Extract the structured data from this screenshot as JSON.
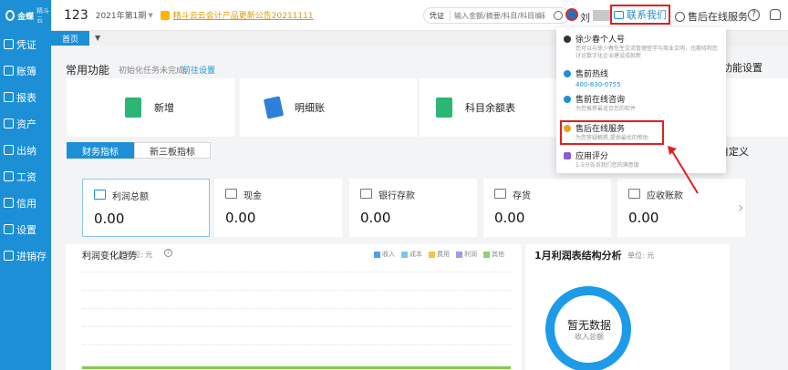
{
  "sidebar": {
    "logo": {
      "name": "金蝶精斗云",
      "brand": "金蝶",
      "product": "精斗云"
    },
    "items": [
      {
        "label": "凭证",
        "icon": "voucher-icon"
      },
      {
        "label": "账簿",
        "icon": "ledger-icon"
      },
      {
        "label": "报表",
        "icon": "report-icon"
      },
      {
        "label": "资产",
        "icon": "asset-icon"
      },
      {
        "label": "出纳",
        "icon": "cashier-icon"
      },
      {
        "label": "工资",
        "icon": "salary-icon"
      },
      {
        "label": "信用",
        "icon": "credit-icon"
      },
      {
        "label": "设置",
        "icon": "settings-icon"
      },
      {
        "label": "进销存",
        "icon": "inventory-icon"
      }
    ]
  },
  "header": {
    "account_no": "123",
    "period": "2021年第1期",
    "notice": "精斗云云会计产品更新公告20211111",
    "search": {
      "type": "凭证",
      "placeholder": "输入金额/摘要/科目/科目编码"
    },
    "user_name": "刘",
    "contact_label": "联系我们",
    "after_sale_label": "售后在线服务"
  },
  "tabstrip": {
    "home": "首页"
  },
  "common": {
    "title": "常用功能",
    "hint": "初始化任务未完成,",
    "link": "前往设置",
    "settings": "功能设置",
    "items": [
      {
        "label": "新增",
        "icon": "add-icon",
        "color": "#2bb673"
      },
      {
        "label": "明细账",
        "icon": "detail-ledger-icon",
        "color": "#2d7fd8"
      },
      {
        "label": "科目余额表",
        "icon": "balance-sheet-icon",
        "color": "#2bb673"
      }
    ]
  },
  "indicator_tabs": {
    "tabs": [
      "财务指标",
      "新三板指标"
    ],
    "customize": "自定义"
  },
  "metrics": [
    {
      "label": "利润总额",
      "value": "0.00"
    },
    {
      "label": "现金",
      "value": "0.00"
    },
    {
      "label": "银行存款",
      "value": "0.00"
    },
    {
      "label": "存货",
      "value": "0.00"
    },
    {
      "label": "应收账款",
      "value": "0.00"
    }
  ],
  "trend": {
    "title": "利润变化趋势",
    "unit": "单位: 元",
    "legend": [
      {
        "label": "收入",
        "color": "#4aa3e8"
      },
      {
        "label": "成本",
        "color": "#7fc4ee"
      },
      {
        "label": "费用",
        "color": "#f6c34a"
      },
      {
        "label": "利润",
        "color": "#9b9ee6"
      },
      {
        "label": "其他",
        "color": "#8fd07a"
      }
    ]
  },
  "structure": {
    "title": "1月利润表结构分析",
    "unit": "单位: 元",
    "empty": "暂无数据",
    "empty_sub": "收入总额"
  },
  "dropdown": {
    "items": [
      {
        "title": "徐少春个人号",
        "desc": "您可以与徐少春先生交流管理哲学与商业文明，也期待和您讨论数字化企业建设成就新",
        "icon_color": "#333333"
      },
      {
        "title": "售前热线",
        "phone": "400-830-0755",
        "icon_color": "#1c8fd6"
      },
      {
        "title": "售前在线咨询",
        "desc": "为您推荐最适合您的软件",
        "icon_color": "#1c8fd6"
      },
      {
        "title": "售后在线服务",
        "desc": "为您答疑解惑,提供最优的帮助",
        "icon_color": "#f0a020"
      },
      {
        "title": "应用评分",
        "desc": "1-5分告诉我们您的满意度",
        "icon_color": "#8a5cd6"
      }
    ]
  }
}
